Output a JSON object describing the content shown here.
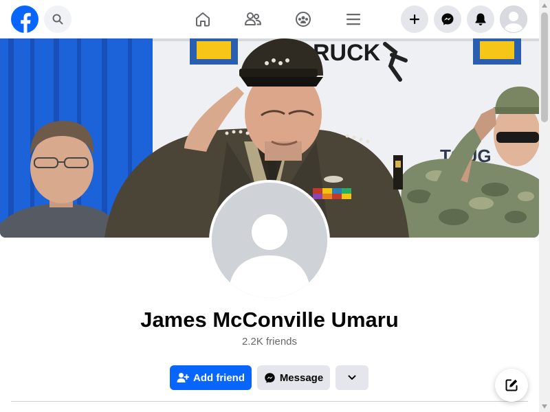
{
  "profile": {
    "name": "James McConville Umaru",
    "friends": "2.2K friends"
  },
  "actions": {
    "add_friend": "Add friend",
    "message": "Message"
  },
  "topbar": {
    "icons": [
      "facebook-logo",
      "search-icon",
      "home-icon",
      "friends-icon",
      "groups-icon",
      "menu-icon",
      "plus-icon",
      "messenger-icon",
      "bell-icon",
      "avatar"
    ]
  },
  "colors": {
    "brand": "#0866ff",
    "button_gray": "#e4e6eb",
    "text_secondary": "#65676b"
  }
}
